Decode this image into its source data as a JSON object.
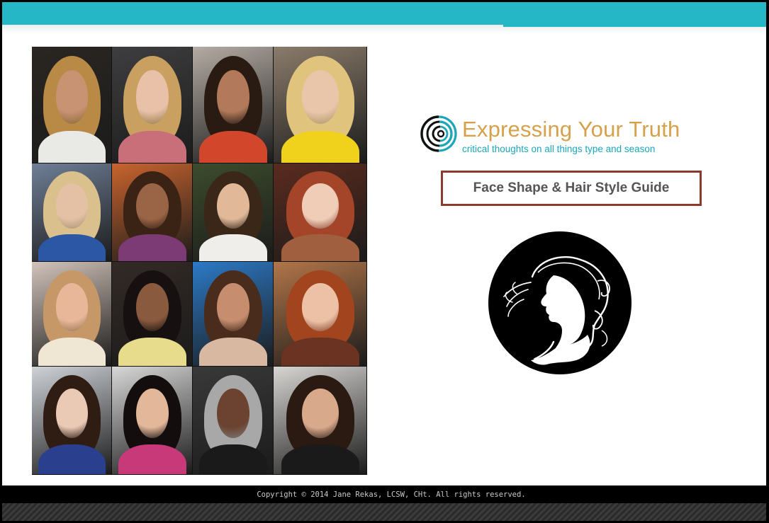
{
  "brand": {
    "title": "Expressing Your Truth",
    "tagline": "critical thoughts on all things type and season",
    "logo_icon": "concentric-circles-icon"
  },
  "guide": {
    "title": "Face Shape & Hair Style Guide"
  },
  "illustration": {
    "icon": "woman-profile-silhouette-icon"
  },
  "footer": {
    "copyright": "Copyright © 2014 Jane Rekas, LCSW, CHt. All rights reserved."
  },
  "colors": {
    "top_bar": "#26b7c7",
    "brand_title": "#d6a14a",
    "brand_tagline": "#1aa7b7",
    "guide_border": "#8c3a2c",
    "footer_bg": "#000000"
  },
  "collage": {
    "rows": 4,
    "columns": 4,
    "photos": [
      {
        "name": "portrait-blonde-curly",
        "hair": "#b98a45",
        "skin": "#c89372",
        "bg": "#2a2622",
        "top": "#e9e9e6"
      },
      {
        "name": "portrait-blonde-updo",
        "hair": "#c9a060",
        "skin": "#e8c1a8",
        "bg": "#3e3e40",
        "top": "#c86f79"
      },
      {
        "name": "portrait-dark-curly",
        "hair": "#2a1b12",
        "skin": "#b27a5a",
        "bg": "#b5aca4",
        "top": "#d2472b"
      },
      {
        "name": "portrait-blonde-long",
        "hair": "#e0c47e",
        "skin": "#e9c6aa",
        "bg": "#8b7c6b",
        "top": "#f0d21c"
      },
      {
        "name": "portrait-blonde-bob",
        "hair": "#d9c08d",
        "skin": "#e4c1a4",
        "bg": "#6f7f97",
        "top": "#2b57a4"
      },
      {
        "name": "portrait-dark-wavy",
        "hair": "#3a2214",
        "skin": "#9a6446",
        "bg": "#c9642e",
        "top": "#7c3b74"
      },
      {
        "name": "portrait-short-dark",
        "hair": "#3b2717",
        "skin": "#e1b999",
        "bg": "#3c4c2c",
        "top": "#efeeea"
      },
      {
        "name": "portrait-red-curly",
        "hair": "#a4452a",
        "skin": "#f0cdb7",
        "bg": "#5b2b1e",
        "top": "#a06040"
      },
      {
        "name": "portrait-short-fair",
        "hair": "#c69867",
        "skin": "#e8b79a",
        "bg": "#d3c4bb",
        "top": "#efe6d4"
      },
      {
        "name": "portrait-long-black",
        "hair": "#161010",
        "skin": "#8a5a3e",
        "bg": "#332a26",
        "top": "#e7dc8b"
      },
      {
        "name": "portrait-brunette-long",
        "hair": "#4a2c1c",
        "skin": "#c68e6e",
        "bg": "#2c7ac7",
        "top": "#d8b8a0"
      },
      {
        "name": "portrait-auburn-long",
        "hair": "#a2451f",
        "skin": "#ecc1a6",
        "bg": "#b27649",
        "top": "#6b3321"
      },
      {
        "name": "portrait-bangs-dark",
        "hair": "#2f1d14",
        "skin": "#ebcab5",
        "bg": "#cfd3d8",
        "top": "#2b3f8f"
      },
      {
        "name": "portrait-straight-black",
        "hair": "#140d0d",
        "skin": "#e3b89a",
        "bg": "#d8d8d8",
        "top": "#c8397a"
      },
      {
        "name": "portrait-silver-short",
        "hair": "#a8a8a8",
        "skin": "#6b4330",
        "bg": "#393939",
        "top": "#1a1a1a"
      },
      {
        "name": "portrait-pixie-dark",
        "hair": "#2a1a12",
        "skin": "#d9a98b",
        "bg": "#d8d6d3",
        "top": "#1a1a1a"
      }
    ]
  }
}
